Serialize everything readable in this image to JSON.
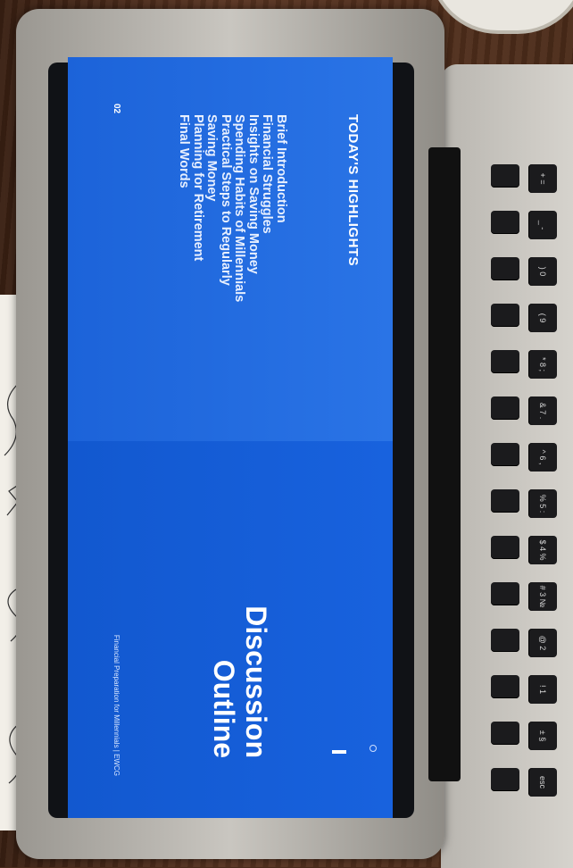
{
  "slide": {
    "left_panel": {
      "title": "TODAY'S HIGHLIGHTS",
      "items": [
        "Brief Introduction",
        "Financial Struggles",
        "Insights on Saving Money",
        "Spending Habits of Millennials",
        "Practical Steps to Regularly",
        "Saving Money",
        "Planning for Retirement",
        "Final Words"
      ],
      "page_number": "02"
    },
    "right_panel": {
      "title_line1": "Discussion",
      "title_line2": "Outline",
      "footer": "Financial Preparation for Millennials | EWCG"
    },
    "colors": {
      "slide_blue": "#1a5fd8",
      "text_white": "#ffffff"
    }
  },
  "keyboard": {
    "visible_keys": [
      "esc",
      "± §",
      "! 1",
      "@ 2",
      "# 3 №",
      "$ 4 %",
      "% 5 :",
      "^ 6 ,",
      "& 7 .",
      "* 8 ;",
      "( 9",
      ") 0",
      "_ -",
      "+ ="
    ]
  }
}
